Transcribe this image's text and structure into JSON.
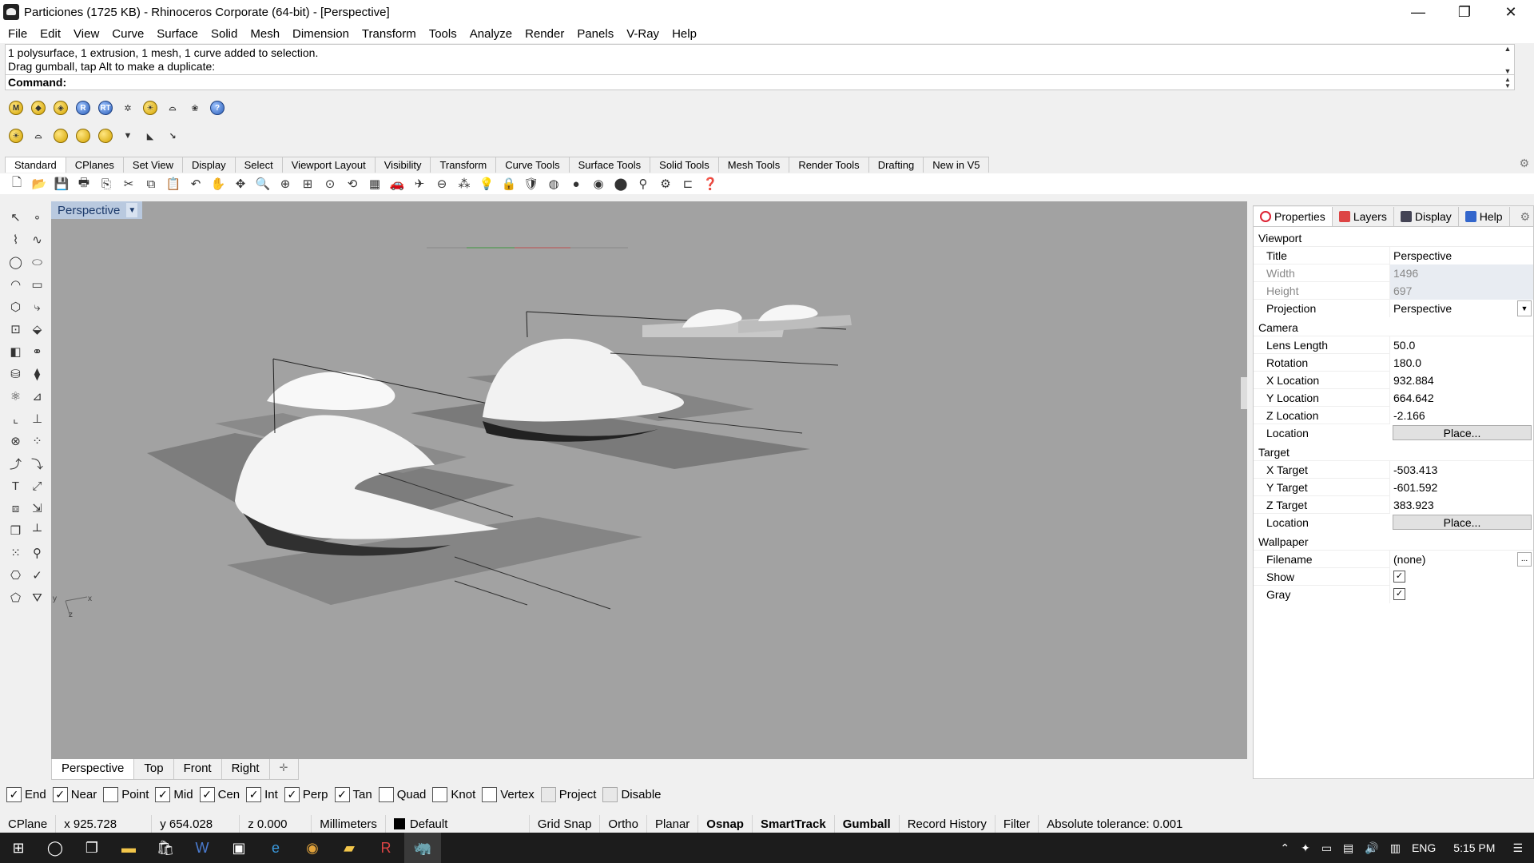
{
  "window": {
    "title": "Particiones (1725 KB) - Rhinoceros Corporate (64-bit) - [Perspective]",
    "minimize": "—",
    "maximize": "❐",
    "close": "✕"
  },
  "menu": [
    "File",
    "Edit",
    "View",
    "Curve",
    "Surface",
    "Solid",
    "Mesh",
    "Dimension",
    "Transform",
    "Tools",
    "Analyze",
    "Render",
    "Panels",
    "V-Ray",
    "Help"
  ],
  "command": {
    "history_line1": "1 polysurface, 1 extrusion, 1 mesh, 1 curve added to selection.",
    "history_line2": "Drag gumball, tap Alt to make a duplicate:",
    "prompt": "Command:"
  },
  "toolbar_tabs": [
    "Standard",
    "CPlanes",
    "Set View",
    "Display",
    "Select",
    "Viewport Layout",
    "Visibility",
    "Transform",
    "Curve Tools",
    "Surface Tools",
    "Solid Tools",
    "Mesh Tools",
    "Render Tools",
    "Drafting",
    "New in V5"
  ],
  "viewport": {
    "label": "Perspective",
    "axis_x": "x",
    "axis_y": "y",
    "axis_z": "z"
  },
  "viewport_tabs": [
    "Perspective",
    "Top",
    "Front",
    "Right"
  ],
  "osnaps": [
    {
      "label": "End",
      "checked": true
    },
    {
      "label": "Near",
      "checked": true
    },
    {
      "label": "Point",
      "checked": false
    },
    {
      "label": "Mid",
      "checked": true
    },
    {
      "label": "Cen",
      "checked": true
    },
    {
      "label": "Int",
      "checked": true
    },
    {
      "label": "Perp",
      "checked": true
    },
    {
      "label": "Tan",
      "checked": true
    },
    {
      "label": "Quad",
      "checked": false
    },
    {
      "label": "Knot",
      "checked": false
    },
    {
      "label": "Vertex",
      "checked": false
    },
    {
      "label": "Project",
      "checked": false
    },
    {
      "label": "Disable",
      "checked": false
    }
  ],
  "status": {
    "cplane": "CPlane",
    "x": "x 925.728",
    "y": "y 654.028",
    "z": "z 0.000",
    "units": "Millimeters",
    "layer": "Default",
    "grid_snap": "Grid Snap",
    "ortho": "Ortho",
    "planar": "Planar",
    "osnap": "Osnap",
    "smarttrack": "SmartTrack",
    "gumball": "Gumball",
    "record_history": "Record History",
    "filter": "Filter",
    "tolerance": "Absolute tolerance: 0.001"
  },
  "panel": {
    "tabs": [
      "Properties",
      "Layers",
      "Display",
      "Help"
    ],
    "viewport_section": "Viewport",
    "title_label": "Title",
    "title_value": "Perspective",
    "width_label": "Width",
    "width_value": "1496",
    "height_label": "Height",
    "height_value": "697",
    "projection_label": "Projection",
    "projection_value": "Perspective",
    "camera_section": "Camera",
    "lens_label": "Lens Length",
    "lens_value": "50.0",
    "rotation_label": "Rotation",
    "rotation_value": "180.0",
    "xloc_label": "X Location",
    "xloc_value": "932.884",
    "yloc_label": "Y Location",
    "yloc_value": "664.642",
    "zloc_label": "Z Location",
    "zloc_value": "-2.166",
    "location_label": "Location",
    "place_button": "Place...",
    "target_section": "Target",
    "xt_label": "X Target",
    "xt_value": "-503.413",
    "yt_label": "Y Target",
    "yt_value": "-601.592",
    "zt_label": "Z Target",
    "zt_value": "383.923",
    "wallpaper_section": "Wallpaper",
    "filename_label": "Filename",
    "filename_value": "(none)",
    "browse_button": "...",
    "show_label": "Show",
    "gray_label": "Gray",
    "show_checked": true,
    "gray_checked": true
  },
  "taskbar": {
    "language": "ENG",
    "time": "5:15 PM"
  },
  "colors": {
    "viewport_bg": "#a2a2a2",
    "viewport_label_bg": "#b9c9df",
    "taskbar_bg": "#1c1c1c"
  }
}
